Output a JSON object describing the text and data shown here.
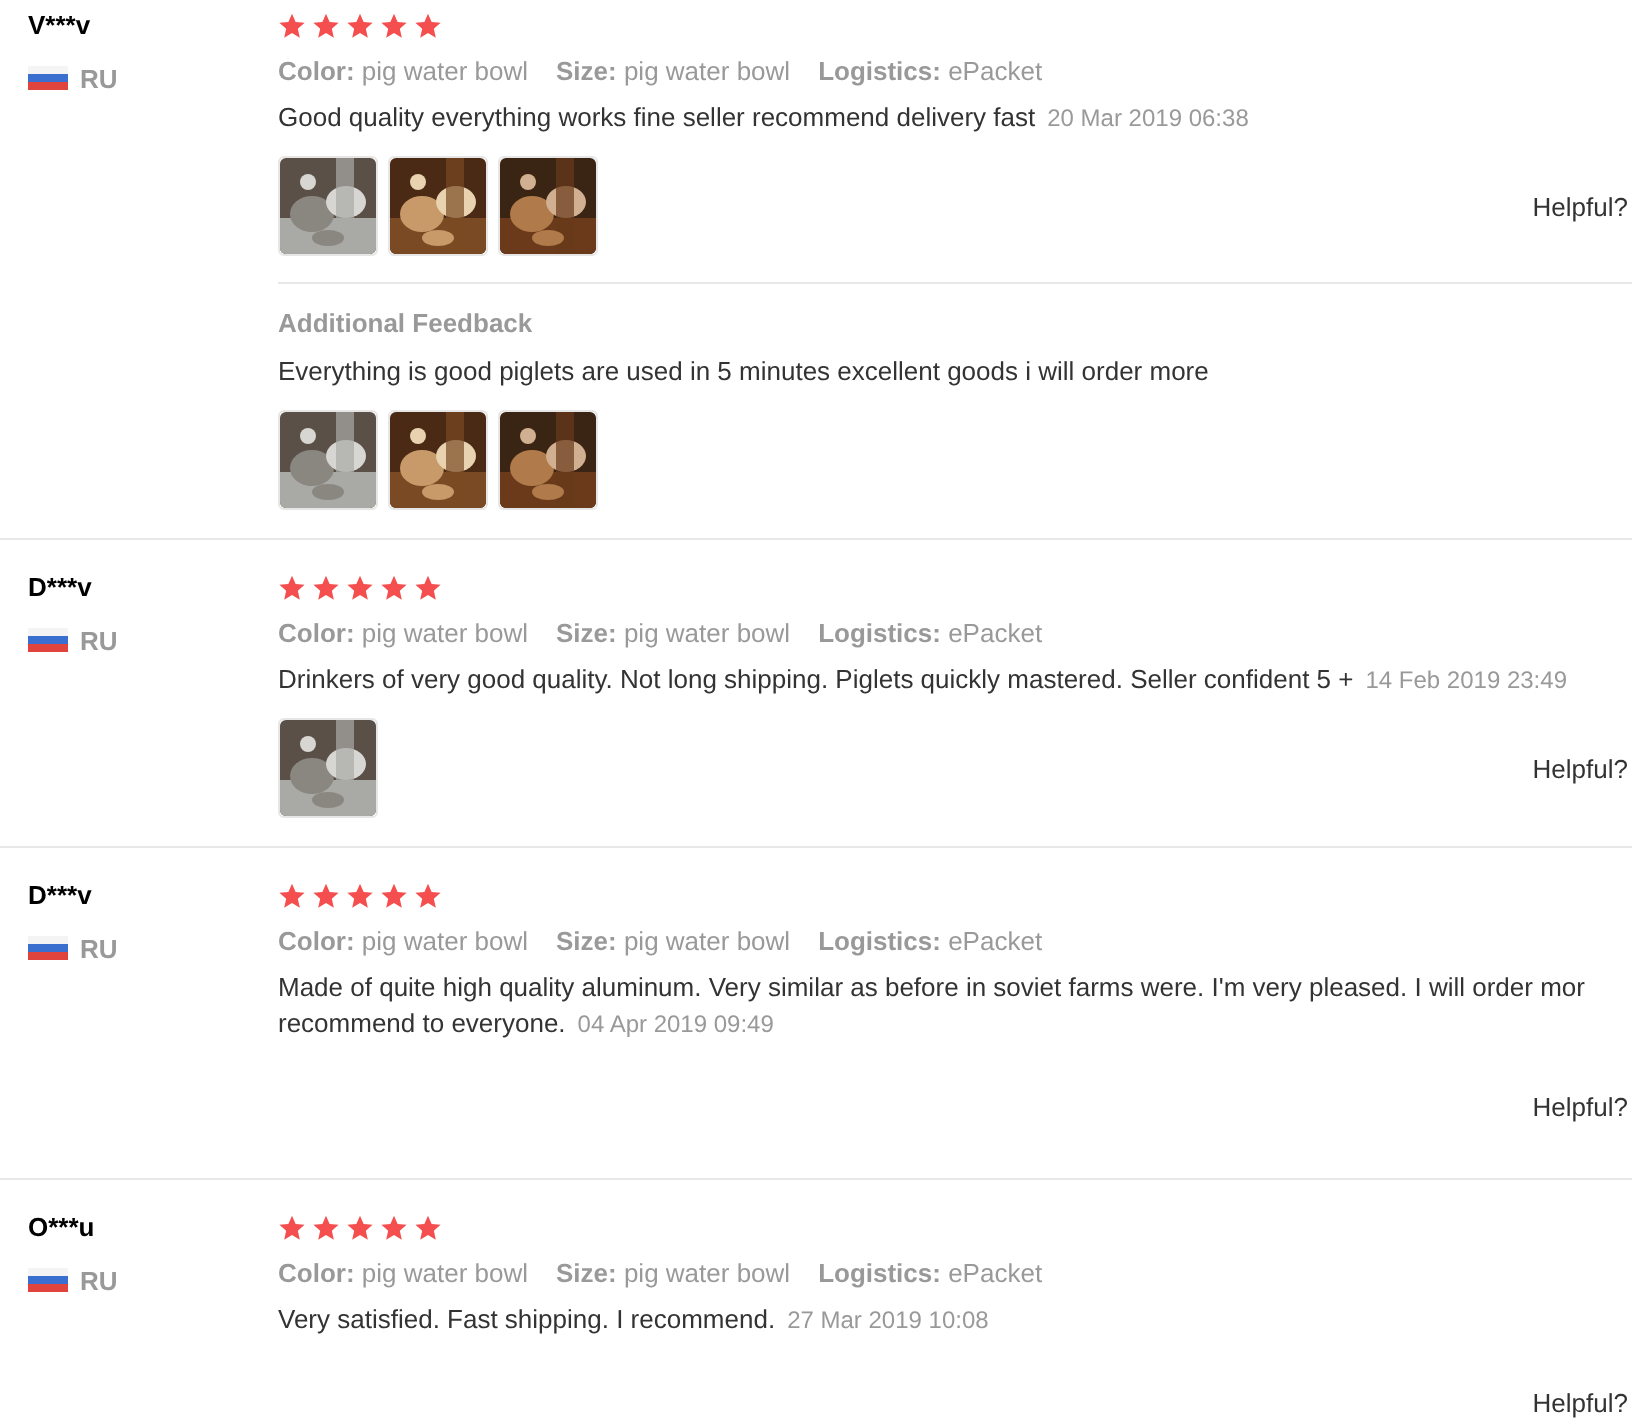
{
  "reviews": [
    {
      "user": "V***v",
      "country": "RU",
      "stars": 5,
      "attributes": [
        {
          "label": "Color:",
          "value": "pig water bowl"
        },
        {
          "label": "Size:",
          "value": "pig water bowl"
        },
        {
          "label": "Logistics:",
          "value": "ePacket"
        }
      ],
      "text": "Good quality everything works fine seller recommend delivery fast",
      "date": "20 Mar 2019 06:38",
      "photos": [
        {
          "kind": "picture"
        },
        {
          "kind": "picture"
        },
        {
          "kind": "picture"
        }
      ],
      "helpful": "Helpful?",
      "additional": {
        "heading": "Additional Feedback",
        "text": "Everything is good piglets are used in 5 minutes excellent goods i will order more",
        "photos": [
          {
            "kind": "picture"
          },
          {
            "kind": "picture"
          },
          {
            "kind": "picture"
          }
        ]
      }
    },
    {
      "user": "D***v",
      "country": "RU",
      "stars": 5,
      "attributes": [
        {
          "label": "Color:",
          "value": "pig water bowl"
        },
        {
          "label": "Size:",
          "value": "pig water bowl"
        },
        {
          "label": "Logistics:",
          "value": "ePacket"
        }
      ],
      "text": "Drinkers of very good quality. Not long shipping. Piglets quickly mastered. Seller confident 5 +",
      "date": "14 Feb 2019 23:49",
      "photos": [
        {
          "kind": "picture"
        }
      ],
      "helpful": "Helpful?"
    },
    {
      "user": "D***v",
      "country": "RU",
      "stars": 5,
      "attributes": [
        {
          "label": "Color:",
          "value": "pig water bowl"
        },
        {
          "label": "Size:",
          "value": "pig water bowl"
        },
        {
          "label": "Logistics:",
          "value": "ePacket"
        }
      ],
      "text": "Made of quite high quality aluminum. Very similar as before in soviet farms were. I'm very pleased. I will order mor\nrecommend to everyone.",
      "date": "04 Apr 2019 09:49",
      "helpful": "Helpful?"
    },
    {
      "user": "O***u",
      "country": "RU",
      "stars": 5,
      "attributes": [
        {
          "label": "Color:",
          "value": "pig water bowl"
        },
        {
          "label": "Size:",
          "value": "pig water bowl"
        },
        {
          "label": "Logistics:",
          "value": "ePacket"
        }
      ],
      "text": "Very satisfied. Fast shipping. I recommend.",
      "date": "27 Mar 2019 10:08",
      "helpful": "Helpful?"
    }
  ]
}
